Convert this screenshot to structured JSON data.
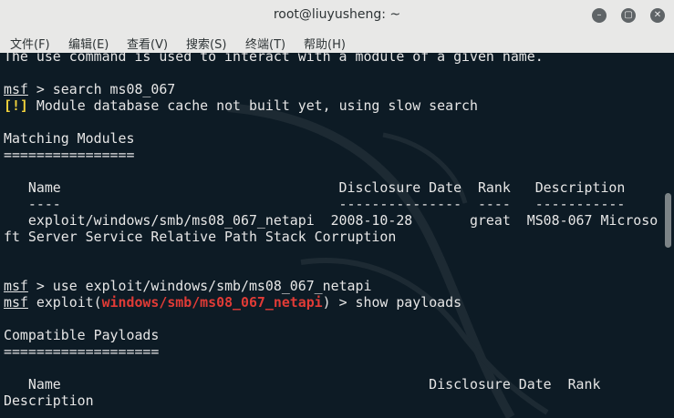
{
  "window": {
    "title": "root@liuyusheng: ~",
    "minimize_icon": "minimize-icon",
    "maximize_icon": "maximize-icon",
    "close_icon": "close-icon"
  },
  "menubar": [
    {
      "label": "文件(F)"
    },
    {
      "label": "编辑(E)"
    },
    {
      "label": "查看(V)"
    },
    {
      "label": "搜索(S)"
    },
    {
      "label": "终端(T)"
    },
    {
      "label": "帮助(H)"
    }
  ],
  "terminal": {
    "line0": "The use command is used to interact with a module of a given name.",
    "prompt": "msf",
    "cmd1": " > search ms08_067",
    "warn_tag": "[!]",
    "warn_text": " Module database cache not built yet, using slow search",
    "matching_title": "Matching Modules",
    "matching_rule": "================",
    "hdr": "   Name                                  Disclosure Date  Rank   Description",
    "hdr_rule": "   ----                                  ---------------  ----   -----------",
    "row1": "   exploit/windows/smb/ms08_067_netapi  2008-10-28       great  MS08-067 Microso",
    "row1_wrap": "ft Server Service Relative Path Stack Corruption",
    "cmd2": " > use exploit/windows/smb/ms08_067_netapi",
    "exploit_prefix": " exploit(",
    "exploit_module": "windows/smb/ms08_067_netapi",
    "exploit_suffix": ") > show payloads",
    "compat_title": "Compatible Payloads",
    "compat_rule": "===================",
    "hdr2": "   Name                                             Disclosure Date  Rank",
    "hdr2_wrap": "Description"
  },
  "colors": {
    "background": "#0d1b25",
    "text": "#e6e6e6",
    "warning": "#f1d23c",
    "module_red": "#e03b36"
  }
}
